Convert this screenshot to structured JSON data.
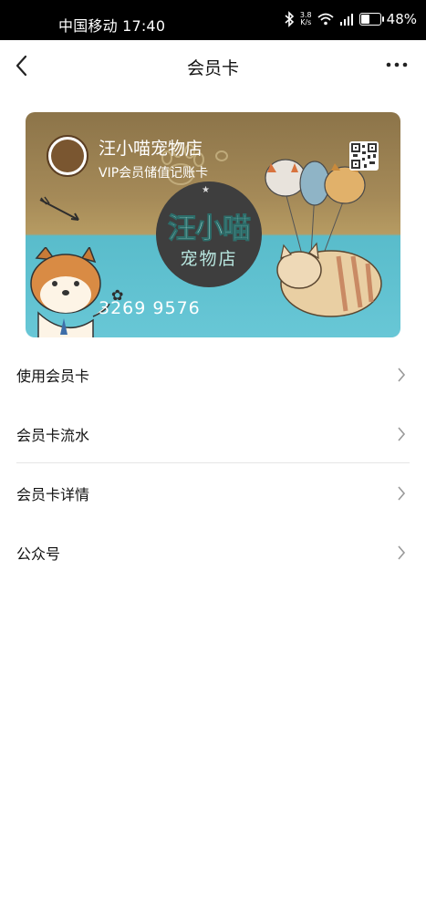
{
  "status_bar": {
    "carrier_time": "中国移动 17:40",
    "net_speed_value": "3.8",
    "net_speed_unit": "K/s",
    "battery_percent": "48%",
    "battery_level": 0.48
  },
  "nav": {
    "title": "会员卡"
  },
  "card": {
    "shop_name": "汪小喵宠物店",
    "card_type": "VIP会员储值记账卡",
    "card_number": "3269 9576",
    "logo_text_line1": "汪小喵",
    "logo_text_line2": "宠物店",
    "background_top_color": "#9a8152",
    "background_bottom_color": "#64c4d3"
  },
  "menu": {
    "items": [
      {
        "label": "使用会员卡"
      },
      {
        "label": "会员卡流水"
      },
      {
        "label": "会员卡详情"
      },
      {
        "label": "公众号"
      }
    ]
  }
}
